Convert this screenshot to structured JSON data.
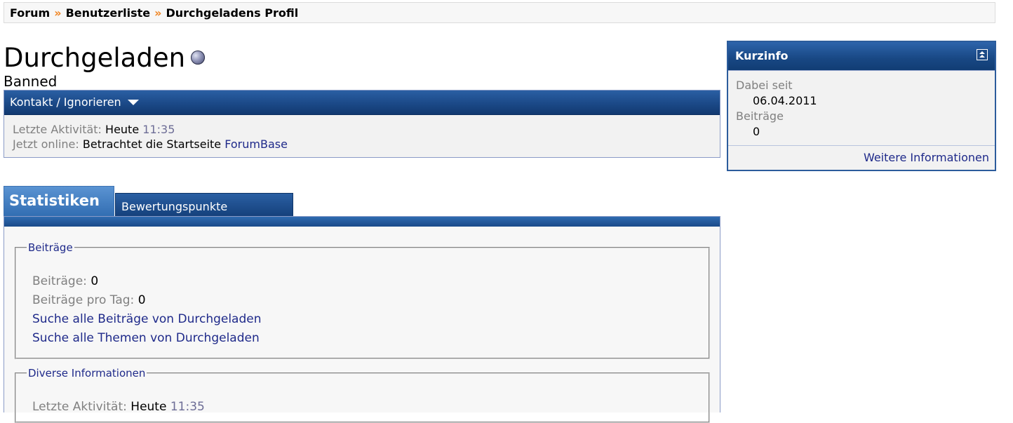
{
  "breadcrumb": {
    "items": [
      "Forum",
      "Benutzerliste",
      "Durchgeladens Profil"
    ],
    "separator": "»"
  },
  "profile": {
    "username": "Durchgeladen",
    "usertitle": "Banned"
  },
  "contact": {
    "menu_label": "Kontakt / Ignorieren",
    "last_activity_label": "Letzte Aktivität:",
    "last_activity_day": "Heute",
    "last_activity_time": "11:35",
    "online_label": "Jetzt online:",
    "online_text": "Betrachtet die Startseite",
    "online_link": "ForumBase"
  },
  "kurzinfo": {
    "title": "Kurzinfo",
    "joined_label": "Dabei seit",
    "joined_value": "06.04.2011",
    "posts_label": "Beiträge",
    "posts_value": "0",
    "more_link": "Weitere Informationen"
  },
  "tabs": [
    {
      "label": "Statistiken",
      "active": true
    },
    {
      "label": "Bewertungspunkte",
      "active": false
    }
  ],
  "stats": {
    "posts_section": {
      "legend": "Beiträge",
      "posts_label": "Beiträge:",
      "posts_value": "0",
      "per_day_label": "Beiträge pro Tag:",
      "per_day_value": "0",
      "search_posts_link": "Suche alle Beiträge von Durchgeladen",
      "search_threads_link": "Suche alle Themen von Durchgeladen"
    },
    "misc_section": {
      "legend": "Diverse Informationen",
      "last_activity_label": "Letzte Aktivität:",
      "last_activity_day": "Heute",
      "last_activity_time": "11:35"
    }
  },
  "colors": {
    "header_blue": "#1a4785",
    "link": "#1f2a8a",
    "breadcrumb_separator": "#f0831f",
    "label_gray": "#808080"
  }
}
